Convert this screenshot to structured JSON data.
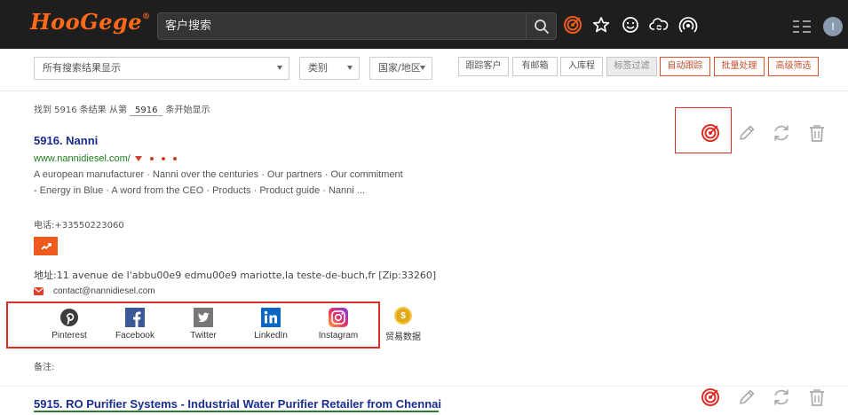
{
  "header": {
    "logo": "HooGege",
    "logo_mark": "®",
    "search_placeholder": "客户搜索",
    "avatar_initial": "I"
  },
  "filters": {
    "search_results_select": "所有搜索结果显示",
    "category_select": "类别",
    "region_select": "国家/地区",
    "buttons": {
      "followed_customers": "跟踪客户",
      "mailbox": "有邮箱",
      "contact": "入库程",
      "marked": "标签过滤",
      "auto_tracking": "自动跟踪",
      "batch_process": "批量处理",
      "advanced_search": "高级筛选"
    }
  },
  "results_summary": {
    "prefix": "找到 5916 条结果  从第",
    "page": "5916",
    "suffix": "条开始显示"
  },
  "result1": {
    "title": "5916. Nanni",
    "url": "www.nannidiesel.com/",
    "description": "A european manufacturer · Nanni over the centuries · Our partners · Our commitment - Energy in Blue · A word from the CEO · Products · Product guide · Nanni ...",
    "phone": "电话:+33550223060",
    "address": "地址:11 avenue de l'abbu00e9 edmu00e9 mariotte,la teste-de-buch,fr [Zip:33260]",
    "email": "contact@nannidiesel.com",
    "social": {
      "pinterest": "Pinterest",
      "facebook": "Facebook",
      "twitter": "Twitter",
      "linkedin": "LinkedIn",
      "instagram": "Instagram"
    },
    "trade_data": "贸易数据",
    "note": "备注:"
  },
  "result2": {
    "title": "5915. RO Purifier Systems - Industrial Water Purifier Retailer from Chennai"
  },
  "colors": {
    "accent": "#ee5a1e",
    "title_blue": "#1a2d8f",
    "url_green": "#1d7c1d",
    "highlight_red": "#d93025"
  }
}
